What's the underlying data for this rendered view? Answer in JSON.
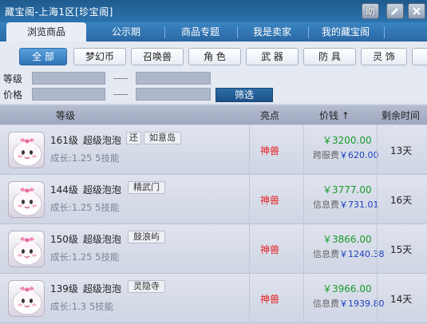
{
  "window": {
    "title": "藏宝阁-上海1区[珍宝阁]",
    "help_label": "助",
    "edit_icon": "edit-icon",
    "close_icon": "close-icon"
  },
  "tabs": [
    {
      "label": "浏览商品",
      "active": true
    },
    {
      "label": "公示期",
      "active": false
    },
    {
      "label": "商品专题",
      "active": false
    },
    {
      "label": "我是卖家",
      "active": false
    },
    {
      "label": "我的藏宝阁",
      "active": false
    }
  ],
  "categories": [
    {
      "label": "全 部",
      "active": true
    },
    {
      "label": "梦幻币",
      "active": false
    },
    {
      "label": "召唤兽",
      "active": false
    },
    {
      "label": "角 色",
      "active": false
    },
    {
      "label": "武 器",
      "active": false
    },
    {
      "label": "防 具",
      "active": false
    },
    {
      "label": "灵 饰",
      "active": false
    }
  ],
  "filters": {
    "level_label": "等级",
    "price_label": "价格",
    "dash": "—",
    "search_label": "筛选"
  },
  "table": {
    "headers": {
      "level": "等级",
      "highlight": "亮点",
      "price": "价钱 ↑",
      "time": "剩余时间"
    },
    "rows": [
      {
        "level": "161级",
        "name": "超级泡泡",
        "badge": "还",
        "location": "如意岛",
        "growth": "成长:1.25 5技能",
        "highlight": "神兽",
        "price": "￥3200.00",
        "fee_label": "跨服费",
        "fee": "￥620.00",
        "time": "13天"
      },
      {
        "level": "144级",
        "name": "超级泡泡",
        "badge": "",
        "location": "精武门",
        "growth": "成长:1.25 5技能",
        "highlight": "神兽",
        "price": "￥3777.00",
        "fee_label": "信息费",
        "fee": "￥731.01",
        "time": "16天"
      },
      {
        "level": "150级",
        "name": "超级泡泡",
        "badge": "",
        "location": "鼓浪屿",
        "growth": "成长:1.25 5技能",
        "highlight": "神兽",
        "price": "￥3866.00",
        "fee_label": "信息费",
        "fee": "￥1240.38",
        "time": "15天"
      },
      {
        "level": "139级",
        "name": "超级泡泡",
        "badge": "",
        "location": "灵隐寺",
        "growth": "成长:1.3 5技能",
        "highlight": "神兽",
        "price": "￥3966.00",
        "fee_label": "信息费",
        "fee": "￥1939.80",
        "time": "14天"
      }
    ]
  },
  "colors": {
    "accent": "#2c74b0",
    "highlight_red": "#e61e1e",
    "price_green": "#1a9a2a",
    "fee_blue": "#1c3fc0"
  }
}
